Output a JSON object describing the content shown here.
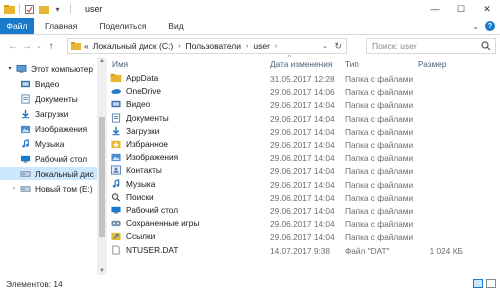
{
  "window": {
    "title": "user",
    "controls": {
      "minimize": "—",
      "maximize": "☐",
      "close": "✕"
    }
  },
  "ribbon": {
    "tabs": [
      "Файл",
      "Главная",
      "Поделиться",
      "Вид"
    ],
    "expand": "⌄",
    "help": "?"
  },
  "address": {
    "prefix": "«",
    "crumbs": [
      "Локальный диск (C:)",
      "Пользователи",
      "user"
    ],
    "separator": "›",
    "dropdown": "⌄",
    "refresh": "↻"
  },
  "search": {
    "placeholder": "Поиск: user"
  },
  "nav_pane": {
    "items": [
      {
        "label": "Этот компьютер",
        "icon": "computer-icon",
        "arrow": "▾",
        "indent": 0
      },
      {
        "label": "Видео",
        "icon": "video-icon",
        "arrow": "",
        "indent": 1
      },
      {
        "label": "Документы",
        "icon": "documents-icon",
        "arrow": "",
        "indent": 1
      },
      {
        "label": "Загрузки",
        "icon": "downloads-icon",
        "arrow": "",
        "indent": 1
      },
      {
        "label": "Изображения",
        "icon": "pictures-icon",
        "arrow": "",
        "indent": 1
      },
      {
        "label": "Музыка",
        "icon": "music-icon",
        "arrow": "",
        "indent": 1
      },
      {
        "label": "Рабочий стол",
        "icon": "desktop-icon",
        "arrow": "",
        "indent": 1
      },
      {
        "label": "Локальный дис",
        "icon": "drive-icon",
        "arrow": "",
        "indent": 1,
        "selected": true
      },
      {
        "label": "Новый том (E:)",
        "icon": "drive-icon",
        "arrow": "›",
        "indent": 1
      }
    ]
  },
  "columns": {
    "name": "Имя",
    "date": "Дата изменения",
    "type": "Тип",
    "size": "Размер"
  },
  "files": [
    {
      "name": "AppData",
      "date": "31.05.2017 12:28",
      "type": "Папка с файлами",
      "size": "",
      "icon": "folder-icon"
    },
    {
      "name": "OneDrive",
      "date": "29.06.2017 14:06",
      "type": "Папка с файлами",
      "size": "",
      "icon": "onedrive-icon"
    },
    {
      "name": "Видео",
      "date": "29.06.2017 14:04",
      "type": "Папка с файлами",
      "size": "",
      "icon": "video-icon"
    },
    {
      "name": "Документы",
      "date": "29.06.2017 14:04",
      "type": "Папка с файлами",
      "size": "",
      "icon": "documents-icon"
    },
    {
      "name": "Загрузки",
      "date": "29.06.2017 14:04",
      "type": "Папка с файлами",
      "size": "",
      "icon": "downloads-icon"
    },
    {
      "name": "Избранное",
      "date": "29.06.2017 14:04",
      "type": "Папка с файлами",
      "size": "",
      "icon": "favorites-icon"
    },
    {
      "name": "Изображения",
      "date": "29.06.2017 14:04",
      "type": "Папка с файлами",
      "size": "",
      "icon": "pictures-icon"
    },
    {
      "name": "Контакты",
      "date": "29.06.2017 14:04",
      "type": "Папка с файлами",
      "size": "",
      "icon": "contacts-icon"
    },
    {
      "name": "Музыка",
      "date": "29.06.2017 14:04",
      "type": "Папка с файлами",
      "size": "",
      "icon": "music-icon"
    },
    {
      "name": "Поиски",
      "date": "29.06.2017 14:04",
      "type": "Папка с файлами",
      "size": "",
      "icon": "searches-icon"
    },
    {
      "name": "Рабочий стол",
      "date": "29.06.2017 14:04",
      "type": "Папка с файлами",
      "size": "",
      "icon": "desktop-icon"
    },
    {
      "name": "Сохраненные игры",
      "date": "29.06.2017 14:04",
      "type": "Папка с файлами",
      "size": "",
      "icon": "saved-games-icon"
    },
    {
      "name": "Ссылки",
      "date": "29.06.2017 14:04",
      "type": "Папка с файлами",
      "size": "",
      "icon": "links-icon"
    },
    {
      "name": "NTUSER.DAT",
      "date": "14.07.2017 9:38",
      "type": "Файл \"DAT\"",
      "size": "1 024 КБ",
      "icon": "file-icon"
    }
  ],
  "status": {
    "count": "Элементов: 14"
  },
  "colors": {
    "accent": "#1979ca",
    "selection": "#cce8ff",
    "header_text": "#4c607a"
  }
}
